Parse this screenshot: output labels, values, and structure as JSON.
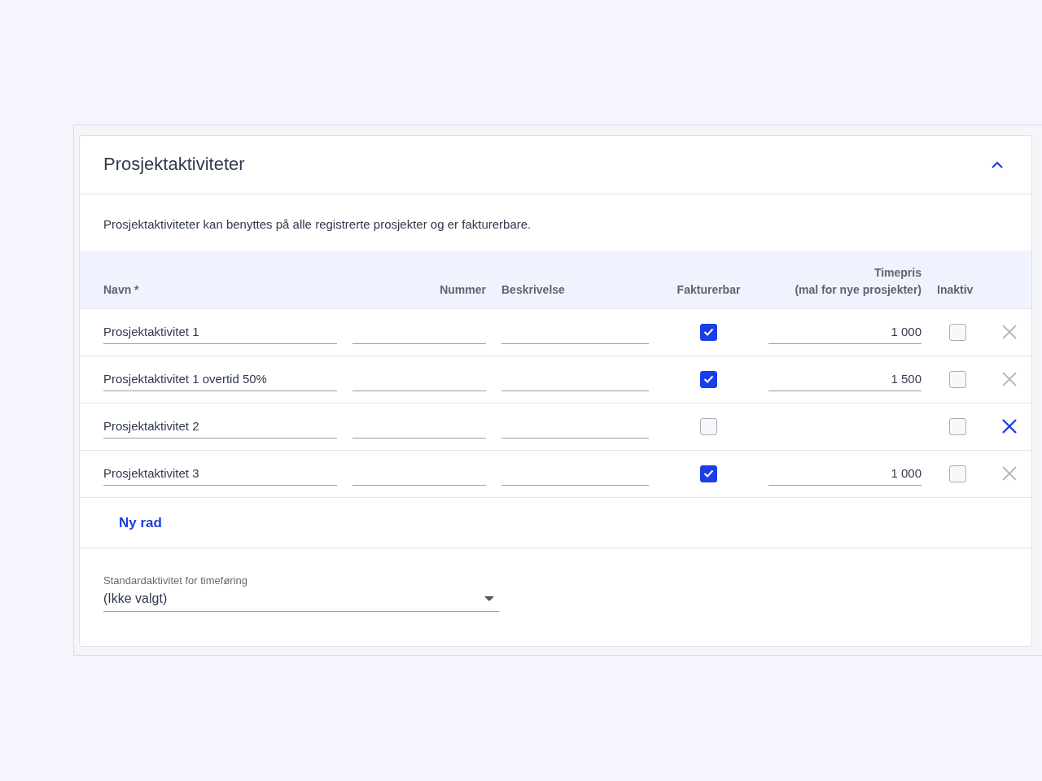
{
  "section": {
    "title": "Prosjektaktiviteter",
    "expanded": true,
    "description": "Prosjektaktiviteter kan benyttes på alle registrerte prosjekter og er fakturerbare."
  },
  "table": {
    "columns": [
      "Navn *",
      "Nummer",
      "Beskrivelse",
      "Fakturerbar",
      "Timepris\n(mal for nye prosjekter)",
      "Inaktiv"
    ],
    "rows": [
      {
        "name": "Prosjektaktivitet 1",
        "number": "",
        "description": "",
        "billable": true,
        "rate": "1 000",
        "inactive": false,
        "delete_highlighted": false
      },
      {
        "name": "Prosjektaktivitet 1 overtid 50%",
        "number": "",
        "description": "",
        "billable": true,
        "rate": "1 500",
        "inactive": false,
        "delete_highlighted": false
      },
      {
        "name": "Prosjektaktivitet 2",
        "number": "",
        "description": "",
        "billable": false,
        "rate": "",
        "inactive": false,
        "delete_highlighted": true
      },
      {
        "name": "Prosjektaktivitet 3",
        "number": "",
        "description": "",
        "billable": true,
        "rate": "1 000",
        "inactive": false,
        "delete_highlighted": false
      }
    ]
  },
  "add_row": "Ny rad",
  "default_activity": {
    "label": "Standardaktivitet for timeføring",
    "value": "(Ikke valgt)"
  }
}
